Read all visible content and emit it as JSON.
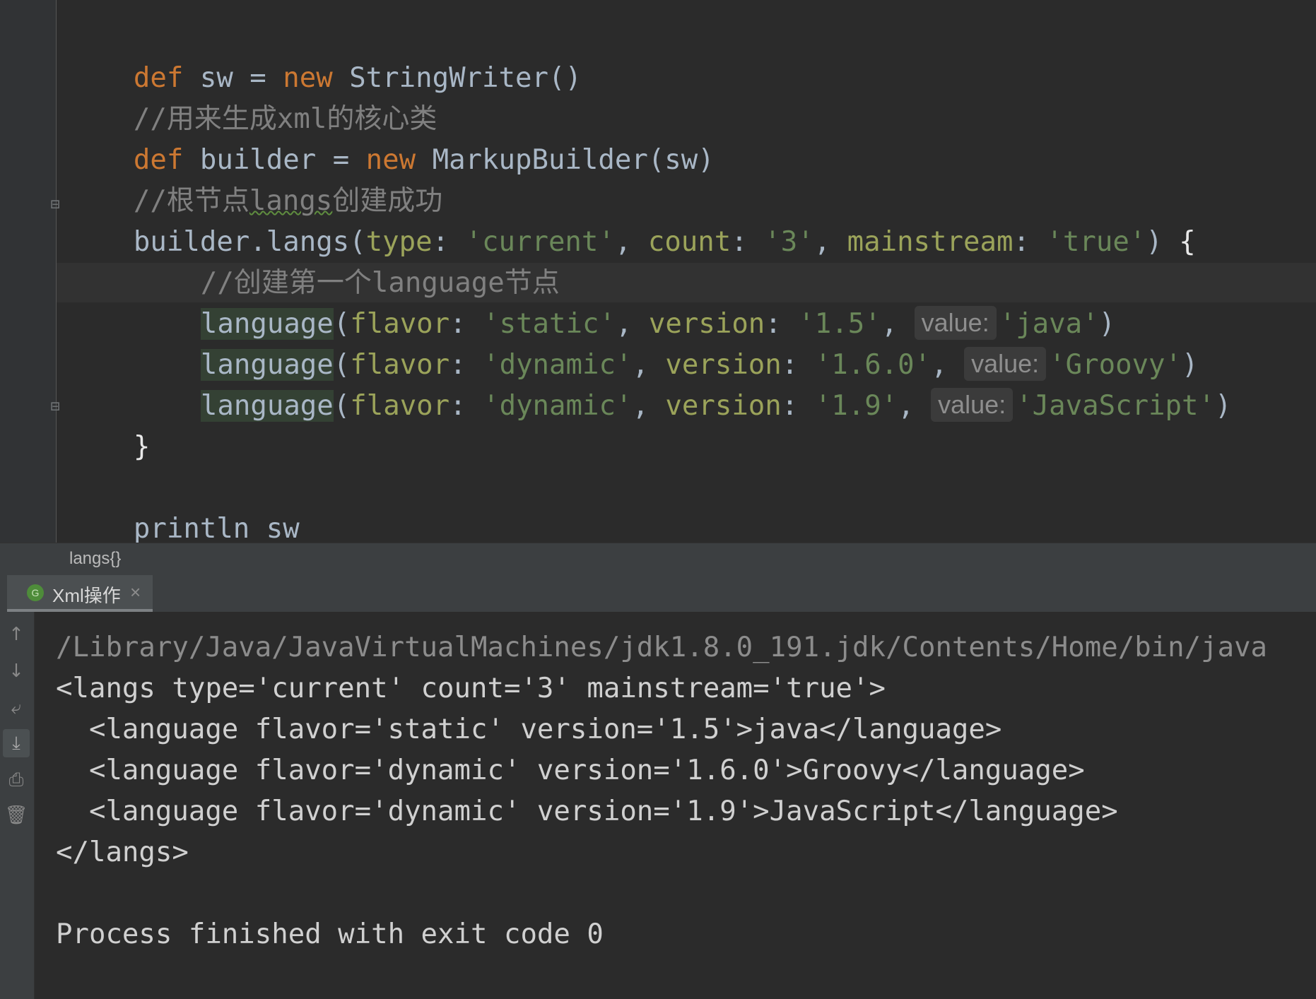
{
  "editor": {
    "lines": {
      "l1": {
        "kw1": "def",
        "t1": " sw = ",
        "kw2": "new",
        "t2": " StringWriter()"
      },
      "l2": {
        "comment": "//用来生成xml的核心类"
      },
      "l3": {
        "kw1": "def",
        "t1": " builder = ",
        "kw2": "new",
        "t2": " MarkupBuilder(sw)"
      },
      "l4": {
        "c1": "//根节点",
        "typo": "langs",
        "c2": "创建成功"
      },
      "l5": {
        "prefix": "builder.langs(",
        "n1": "type",
        "colon1": ": ",
        "s1": "'current'",
        "sep1": ", ",
        "n2": "count",
        "colon2": ": ",
        "s2": "'3'",
        "sep2": ", ",
        "n3": "mainstream",
        "colon3": ": ",
        "s3": "'true'",
        "close": ") ",
        "brace": "{"
      },
      "l6": {
        "comment": "//创建第一个language节点"
      },
      "l7": {
        "method": "language",
        "open": "(",
        "n1": "flavor",
        "c1": ": ",
        "s1": "'static'",
        "sep1": ", ",
        "n2": "version",
        "c2": ": ",
        "s2": "'1.5'",
        "sep2": ", ",
        "hint": "value:",
        "s3": "'java'",
        "close": ")"
      },
      "l8": {
        "method": "language",
        "open": "(",
        "n1": "flavor",
        "c1": ": ",
        "s1": "'dynamic'",
        "sep1": ", ",
        "n2": "version",
        "c2": ": ",
        "s2": "'1.6.0'",
        "sep2": ", ",
        "hint": "value:",
        "s3": "'Groovy'",
        "close": ")"
      },
      "l9": {
        "method": "language",
        "open": "(",
        "n1": "flavor",
        "c1": ": ",
        "s1": "'dynamic'",
        "sep1": ", ",
        "n2": "version",
        "c2": ": ",
        "s2": "'1.9'",
        "sep2": ", ",
        "hint": "value:",
        "s3": "'JavaScript'",
        "close": ")"
      },
      "l10": {
        "brace": "}"
      },
      "l12": {
        "text": "println sw"
      }
    }
  },
  "breadcrumb": {
    "text": "langs{}"
  },
  "run_tab": {
    "icon": "G",
    "label": "Xml操作",
    "close": "×"
  },
  "console": {
    "lines": [
      "/Library/Java/JavaVirtualMachines/jdk1.8.0_191.jdk/Contents/Home/bin/java",
      "<langs type='current' count='3' mainstream='true'>",
      "  <language flavor='static' version='1.5'>java</language>",
      "  <language flavor='dynamic' version='1.6.0'>Groovy</language>",
      "  <language flavor='dynamic' version='1.9'>JavaScript</language>",
      "</langs>",
      "",
      "Process finished with exit code 0"
    ]
  },
  "toolbar_icons": [
    "arrow-up-icon",
    "arrow-down-icon",
    "soft-wrap-icon",
    "scroll-to-end-icon",
    "print-icon",
    "trash-icon"
  ],
  "colors": {
    "background": "#2b2b2b",
    "keyword": "#cc7832",
    "string": "#6a8759",
    "named_arg": "#9ba35a",
    "comment": "#808080",
    "text": "#a9b7c6"
  }
}
